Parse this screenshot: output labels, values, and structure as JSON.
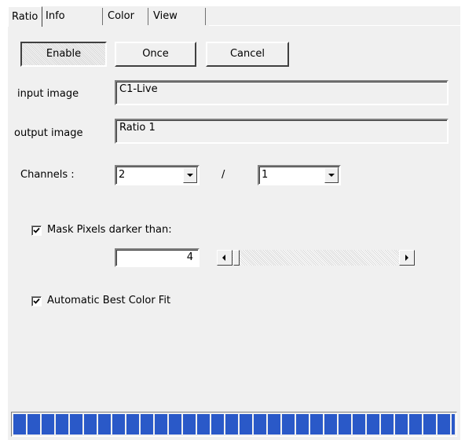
{
  "tabs": [
    {
      "label": "Ratio",
      "active": true
    },
    {
      "label": "Info",
      "active": false
    },
    {
      "label": "Color",
      "active": false
    },
    {
      "label": "View",
      "active": false
    }
  ],
  "buttons": {
    "enable": "Enable",
    "once": "Once",
    "cancel": "Cancel"
  },
  "fields": {
    "input_label": "input  image",
    "input_value": "C1-Live",
    "output_label": "output image",
    "output_value": "Ratio 1"
  },
  "channels": {
    "label": "Channels :",
    "numerator": "2",
    "separator": "/",
    "denominator": "1"
  },
  "mask": {
    "label": "Mask Pixels darker than:",
    "checked": true,
    "value": "4",
    "slider_fraction": 0.0
  },
  "auto_color": {
    "label": "Automatic Best Color Fit",
    "checked": true
  },
  "progress": {
    "fraction": 1.0,
    "color": "#2a59c8"
  }
}
